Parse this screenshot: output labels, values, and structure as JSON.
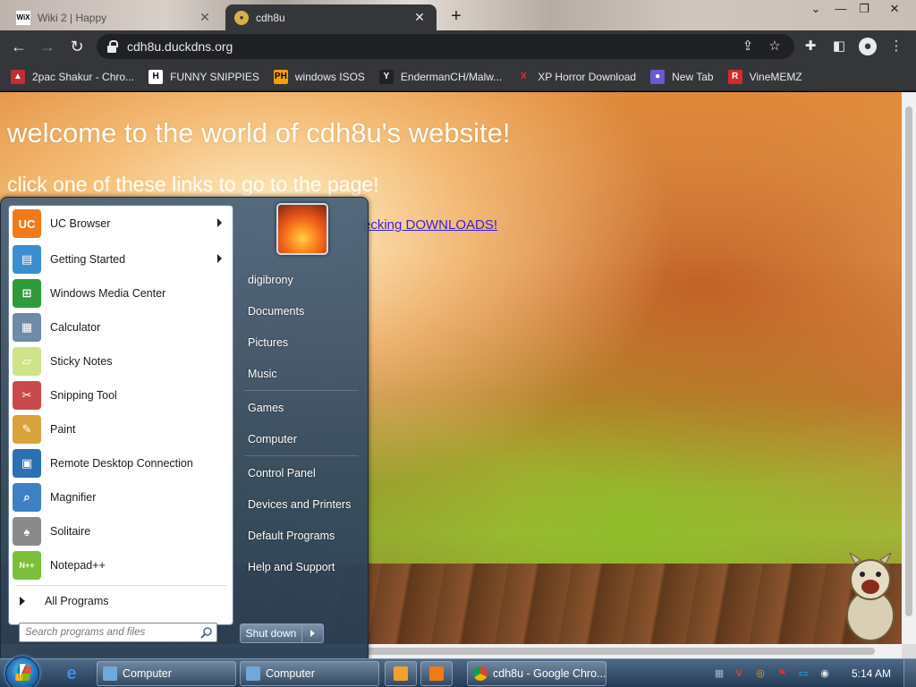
{
  "browser": {
    "tabs": [
      {
        "title": "Wiki 2 | Happy",
        "icon": "wix-favicon",
        "active": false
      },
      {
        "title": "cdh8u",
        "icon": "site-favicon",
        "active": true
      }
    ],
    "close_glyph": "✕",
    "newtab_glyph": "+",
    "window_controls": {
      "minimize": "—",
      "restore": "❐",
      "close": "✕"
    },
    "url": "cdh8u.duckdns.org",
    "bookmarks": [
      {
        "label": "2pac Shakur - Chro...",
        "icon": "bookmark-2pac-icon",
        "glyph": "▲"
      },
      {
        "label": "FUNNY SNIPPIES",
        "icon": "bookmark-h-icon",
        "glyph": "H"
      },
      {
        "label": "windows ISOS",
        "icon": "bookmark-ph-icon",
        "glyph": "PH"
      },
      {
        "label": "EndermanCH/Malw...",
        "icon": "bookmark-yc-icon",
        "glyph": "Y"
      },
      {
        "label": "XP Horror Download",
        "icon": "bookmark-x-icon",
        "glyph": "X"
      },
      {
        "label": "New Tab",
        "icon": "bookmark-newtab-icon",
        "glyph": "●"
      },
      {
        "label": "VineMEMZ",
        "icon": "bookmark-r-icon",
        "glyph": "R"
      }
    ]
  },
  "page": {
    "heading": "welcome to the world of cdh8u's website!",
    "subheading": "click one of these links to go to the page!",
    "partial_link": "ecking DOWNLOADS!"
  },
  "start_menu": {
    "programs": [
      {
        "label": "UC Browser",
        "icon": "uc-browser-icon",
        "glyph": "UC",
        "color": "#f07a1a",
        "submenu": true
      },
      {
        "label": "Getting Started",
        "icon": "getting-started-icon",
        "glyph": "▤",
        "color": "#3a8fd0",
        "submenu": true
      },
      {
        "label": "Windows Media Center",
        "icon": "media-center-icon",
        "glyph": "⊞",
        "color": "#2f9a3a",
        "submenu": false
      },
      {
        "label": "Calculator",
        "icon": "calculator-icon",
        "glyph": "▦",
        "color": "#6d8aa6",
        "submenu": false
      },
      {
        "label": "Sticky Notes",
        "icon": "sticky-notes-icon",
        "glyph": "▱",
        "color": "#cfe38a",
        "submenu": false
      },
      {
        "label": "Snipping Tool",
        "icon": "snipping-tool-icon",
        "glyph": "✂",
        "color": "#c94a4a",
        "submenu": false
      },
      {
        "label": "Paint",
        "icon": "paint-icon",
        "glyph": "✎",
        "color": "#d9a23a",
        "submenu": false
      },
      {
        "label": "Remote Desktop Connection",
        "icon": "remote-desktop-icon",
        "glyph": "▣",
        "color": "#2c6fb3",
        "submenu": false
      },
      {
        "label": "Magnifier",
        "icon": "magnifier-icon",
        "glyph": "⌕",
        "color": "#3f7fc4",
        "submenu": false
      },
      {
        "label": "Solitaire",
        "icon": "solitaire-icon",
        "glyph": "♠",
        "color": "#8a8a8a",
        "submenu": false
      },
      {
        "label": "Notepad++",
        "icon": "notepad-plus-plus-icon",
        "glyph": "N++",
        "color": "#7cbf3a",
        "submenu": false
      }
    ],
    "all_programs": "All Programs",
    "search_placeholder": "Search programs and files",
    "user_links": [
      "digibrony",
      "Documents",
      "Pictures",
      "Music",
      "Games",
      "Computer",
      "Control Panel",
      "Devices and Printers",
      "Default Programs",
      "Help and Support"
    ],
    "shutdown": "Shut down"
  },
  "taskbar": {
    "pinned": [
      {
        "icon": "internet-explorer-icon",
        "glyph": "e",
        "color": "#3d8fe0"
      }
    ],
    "buttons": [
      {
        "label": "Computer",
        "icon": "computer-icon"
      },
      {
        "label": "Computer",
        "icon": "computer-icon"
      },
      {
        "label": "",
        "icon": "media-player-icon"
      },
      {
        "label": "",
        "icon": "uc-browser-icon"
      },
      {
        "label": "cdh8u - Google Chro...",
        "icon": "chrome-icon"
      }
    ],
    "tray": [
      {
        "icon": "tray-network-icon",
        "glyph": "▦",
        "color": "#9fb7cc"
      },
      {
        "icon": "tray-v-icon",
        "glyph": "V",
        "color": "#e04040"
      },
      {
        "icon": "tray-search-icon",
        "glyph": "◎",
        "color": "#f0a020"
      },
      {
        "icon": "tray-flag-icon",
        "glyph": "⚑",
        "color": "#e03030"
      },
      {
        "icon": "tray-display-icon",
        "glyph": "▭",
        "color": "#30b0e0"
      },
      {
        "icon": "tray-volume-icon",
        "glyph": "◉",
        "color": "#e8e8e8"
      }
    ],
    "clock": "5:14 AM"
  }
}
